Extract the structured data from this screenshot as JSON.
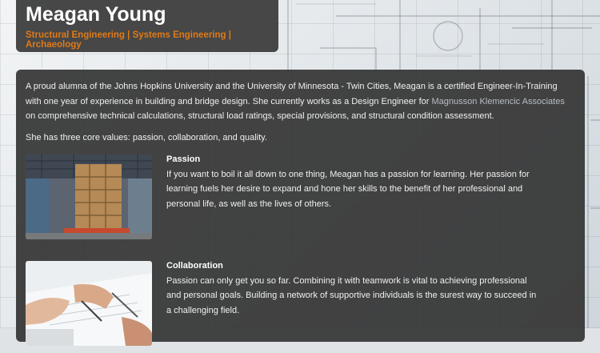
{
  "header": {
    "name": "Meagan Young",
    "disciplines": [
      "Structural Engineering",
      "Systems Engineering",
      "Archaeology"
    ],
    "separator": " | "
  },
  "intro": {
    "part1": "A proud alumna of the Johns Hopkins University and the University of Minnesota - Twin Cities, Meagan is a certified Engineer-In-Training with one year of experience in building and bridge design. She currently works as a Design Engineer for ",
    "company": "Magnusson Klemencic Associates",
    "part2": " on comprehensive technical calculations, structural load ratings, special provisions, and structural condition assessment.",
    "values": "She has three core values: passion, collaboration, and quality."
  },
  "features": [
    {
      "title": "Passion",
      "body": "If you want to boil it all down to one thing, Meagan has a passion for learning. Her passion for learning fuels her desire to expand and hone her skills to the benefit of her professional and personal life, as well as the lives of others."
    },
    {
      "title": "Collaboration",
      "body": "Passion can only get you so far. Combining it with teamwork is vital to achieving professional and personal goals. Building a network of supportive individuals is the surest way to succeed in a challenging field."
    }
  ],
  "colors": {
    "accent": "#e07a17",
    "card": "#303030",
    "link": "#b8bfc6"
  }
}
